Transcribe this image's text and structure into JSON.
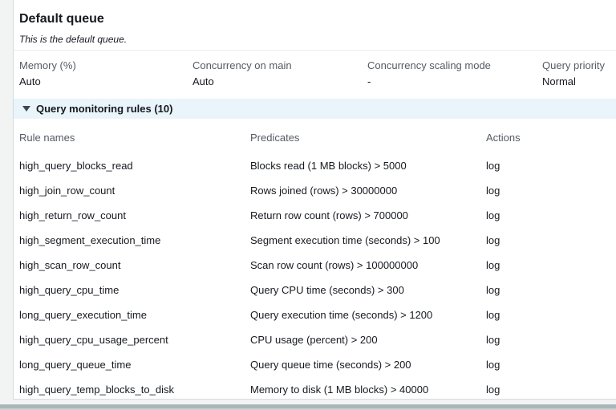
{
  "queue": {
    "title": "Default queue",
    "subtitle": "This is the default queue."
  },
  "summary": {
    "fields": [
      {
        "label": "Memory (%)",
        "value": "Auto"
      },
      {
        "label": "Concurrency on main",
        "value": "Auto"
      },
      {
        "label": "Concurrency scaling mode",
        "value": "-"
      },
      {
        "label": "Query priority",
        "value": "Normal"
      }
    ]
  },
  "monitoring": {
    "header": "Query monitoring rules (10)",
    "expanded": true,
    "caret_icon": "triangle-down",
    "columns": [
      "Rule names",
      "Predicates",
      "Actions"
    ],
    "rows": [
      {
        "rule": "high_query_blocks_read",
        "predicate": "Blocks read (1 MB blocks) > 5000",
        "action": "log"
      },
      {
        "rule": "high_join_row_count",
        "predicate": "Rows joined (rows) > 30000000",
        "action": "log"
      },
      {
        "rule": "high_return_row_count",
        "predicate": "Return row count (rows) > 700000",
        "action": "log"
      },
      {
        "rule": "high_segment_execution_time",
        "predicate": "Segment execution time (seconds) > 100",
        "action": "log"
      },
      {
        "rule": "high_scan_row_count",
        "predicate": "Scan row count (rows) > 100000000",
        "action": "log"
      },
      {
        "rule": "high_query_cpu_time",
        "predicate": "Query CPU time (seconds) > 300",
        "action": "log"
      },
      {
        "rule": "long_query_execution_time",
        "predicate": "Query execution time (seconds) > 1200",
        "action": "log"
      },
      {
        "rule": "high_query_cpu_usage_percent",
        "predicate": "CPU usage (percent) > 200",
        "action": "log"
      },
      {
        "rule": "long_query_queue_time",
        "predicate": "Query queue time (seconds) > 200",
        "action": "log"
      },
      {
        "rule": "high_query_temp_blocks_to_disk",
        "predicate": "Memory to disk (1 MB blocks) > 40000",
        "action": "log"
      }
    ]
  },
  "colors": {
    "page_background": "#f2f3f3",
    "card_background": "#ffffff",
    "card_border": "#d5dbdb",
    "divider": "#eaeded",
    "label_text": "#545b64",
    "primary_text": "#16191f",
    "expand_header_background": "#e9f4fb",
    "bottom_bar": "#aab5b8"
  }
}
